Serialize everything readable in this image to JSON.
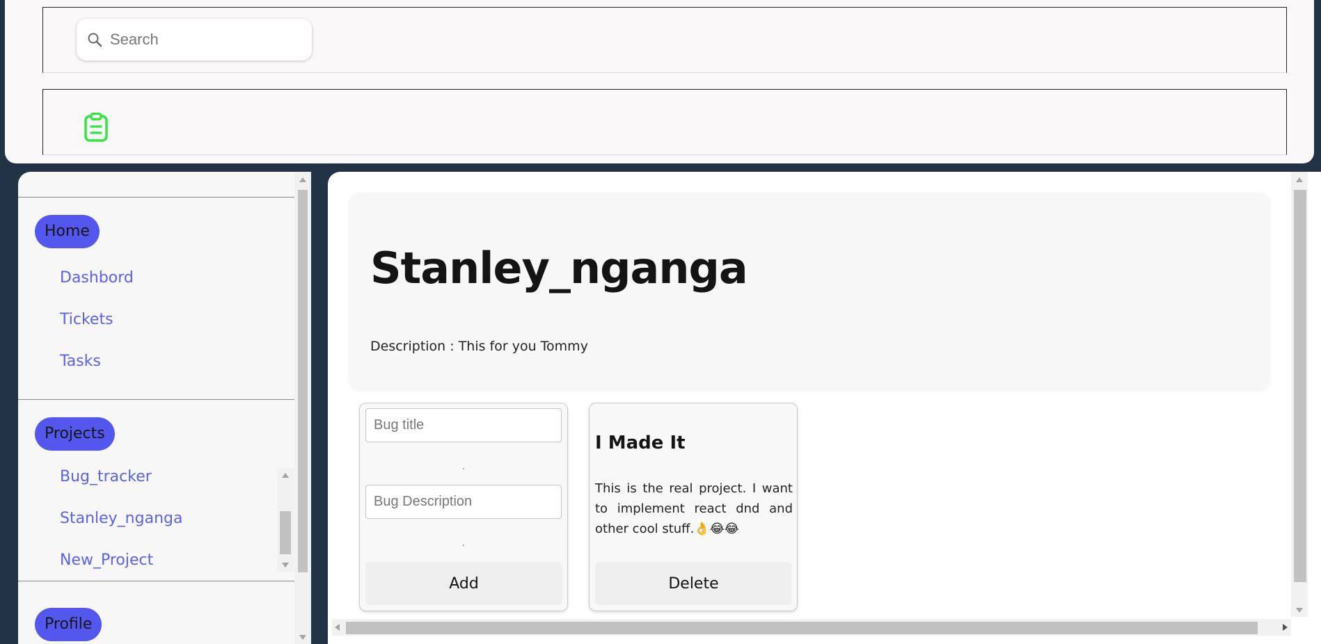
{
  "header": {
    "search": {
      "placeholder": "Search",
      "value": ""
    },
    "icons": {
      "search": "search-icon",
      "logo": "clipboard-icon"
    },
    "colors": {
      "logo": "#2ee63c"
    }
  },
  "sidebar": {
    "sections": [
      {
        "label": "Home",
        "items": [
          {
            "label": "Dashbord"
          },
          {
            "label": "Tickets"
          },
          {
            "label": "Tasks"
          }
        ]
      },
      {
        "label": "Projects",
        "items": [
          {
            "label": "Bug_tracker"
          },
          {
            "label": "Stanley_nganga"
          },
          {
            "label": "New_Project"
          }
        ]
      },
      {
        "label": "Profile",
        "items": []
      }
    ],
    "colors": {
      "pill": "#5457ee",
      "link": "#5d60ea"
    }
  },
  "main": {
    "project": {
      "title": "Stanley_nganga",
      "description": "Description : This for you Tommy"
    },
    "bug_form": {
      "title_placeholder": "Bug title",
      "description_placeholder": "Bug Description",
      "add_label": "Add"
    },
    "bugs": [
      {
        "title": "I Made It",
        "description": "This is the real project. I want to implement react dnd and other cool stuff.👌😂😂",
        "delete_label": "Delete"
      }
    ]
  }
}
